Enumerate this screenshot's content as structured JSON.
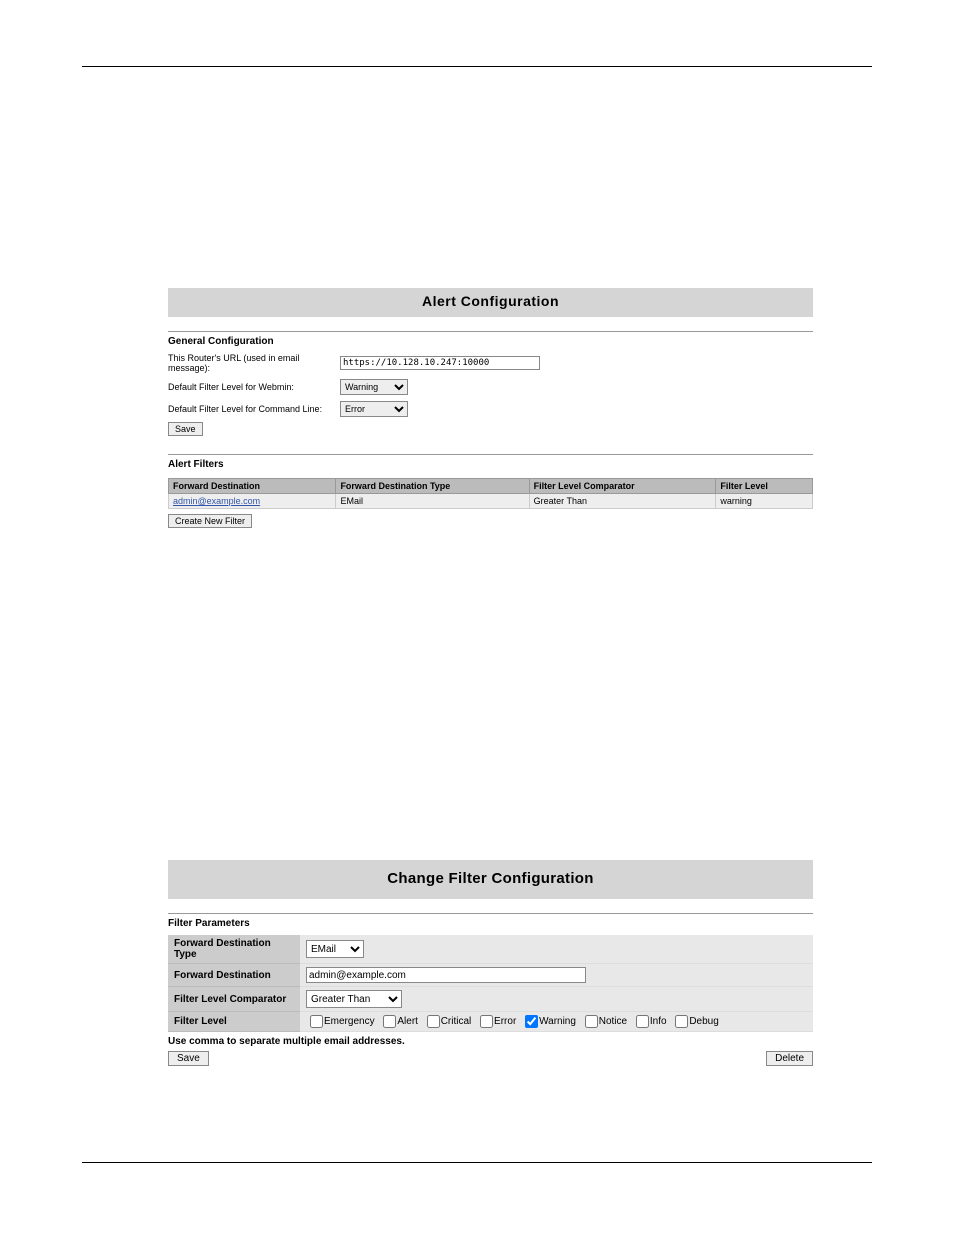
{
  "panel1": {
    "title": "Alert Configuration",
    "general": {
      "heading": "General Configuration",
      "url_label": "This Router's URL (used in email message):",
      "url_value": "https://10.128.10.247:10000",
      "webmin_label": "Default Filter Level for Webmin:",
      "webmin_value": "Warning",
      "cmdline_label": "Default Filter Level for Command Line:",
      "cmdline_value": "Error",
      "save_label": "Save"
    },
    "filters": {
      "heading": "Alert Filters",
      "cols": {
        "dest": "Forward Destination",
        "type": "Forward Destination Type",
        "comp": "Filter Level Comparator",
        "level": "Filter Level"
      },
      "row": {
        "dest": "admin@example.com",
        "type": "EMail",
        "comp": "Greater Than",
        "level": "warning"
      },
      "create_label": "Create New Filter"
    }
  },
  "panel2": {
    "title": "Change Filter Configuration",
    "heading": "Filter Parameters",
    "rows": {
      "type_label": "Forward Destination Type",
      "type_value": "EMail",
      "dest_label": "Forward Destination",
      "dest_value": "admin@example.com",
      "comp_label": "Filter Level Comparator",
      "comp_value": "Greater Than",
      "level_label": "Filter Level"
    },
    "levels": {
      "emergency": "Emergency",
      "alert": "Alert",
      "critical": "Critical",
      "error": "Error",
      "warning": "Warning",
      "notice": "Notice",
      "info": "Info",
      "debug": "Debug"
    },
    "checked": "warning",
    "note": "Use comma to separate multiple email addresses.",
    "save_label": "Save",
    "delete_label": "Delete"
  }
}
